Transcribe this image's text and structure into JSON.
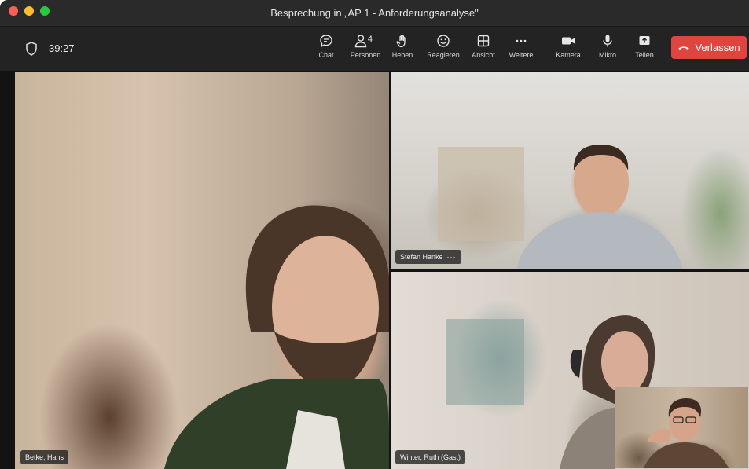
{
  "window": {
    "title": "Besprechung in „AP 1 - Anforderungsanalyse\""
  },
  "toolbar": {
    "timer": "39:27",
    "buttons": {
      "chat": "Chat",
      "people": "Personen",
      "people_count": "4",
      "raise": "Heben",
      "react": "Reagieren",
      "view": "Ansicht",
      "more": "Weitere",
      "camera": "Kamera",
      "mic": "Mikro",
      "share": "Teilen"
    },
    "leave": "Verlassen",
    "leave_color": "#e0443e"
  },
  "participants": [
    {
      "name": "Betke, Hans"
    },
    {
      "name": "Stefan Hanke",
      "more": "···"
    },
    {
      "name": "Winter, Ruth (Gast)"
    }
  ],
  "icons": [
    "shield-icon",
    "chat-icon",
    "people-icon",
    "raise-hand-icon",
    "smiley-icon",
    "view-grid-icon",
    "more-icon",
    "camera-icon",
    "mic-icon",
    "share-icon",
    "phone-hangup-icon"
  ]
}
